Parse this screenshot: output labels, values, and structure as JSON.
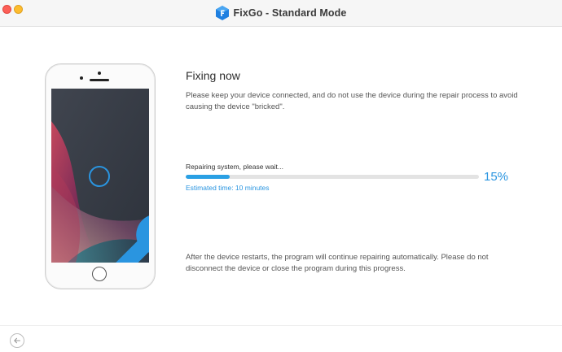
{
  "window": {
    "title": "FixGo - Standard Mode",
    "logo_icon": "fixgo-logo-icon"
  },
  "device": {
    "icon": "wrench-icon"
  },
  "main": {
    "heading": "Fixing now",
    "description": "Please keep your device connected, and do not use the device during the repair process to avoid causing the device \"bricked\".",
    "status_label": "Repairing system, please wait...",
    "progress_percent": 15,
    "progress_text": "15%",
    "estimated_time": "Estimated time: 10 minutes",
    "footnote": "After the device restarts, the program will continue repairing automatically. Please do not disconnect the device or close the program during this progress."
  },
  "footer": {
    "back_icon": "back-arrow-icon"
  },
  "colors": {
    "accent": "#2a95e0",
    "progress_track": "#e3e3e3"
  }
}
